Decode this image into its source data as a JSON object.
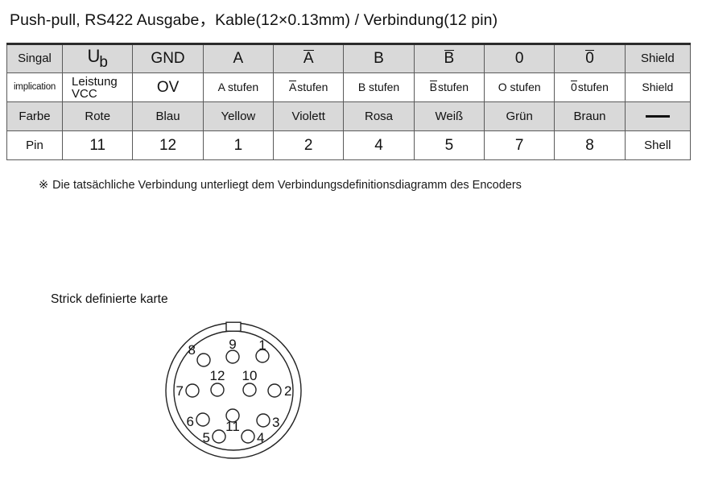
{
  "title": "Push-pull, RS422 Ausgabe，Kable(12×0.13mm)  / Verbindung(12 pin)",
  "table": {
    "rows": [
      {
        "name": "signal-row",
        "cells": [
          "Singal",
          "Ub",
          "GND",
          "A",
          "A",
          "B",
          "B",
          "0",
          "0",
          "Shield"
        ]
      },
      {
        "name": "implication-row",
        "cells": [
          "implication",
          "Leistung VCC",
          "OV",
          "A stufen",
          "A stufen",
          "B stufen",
          "B stufen",
          "O stufen",
          "0 stufen",
          "Shield"
        ]
      },
      {
        "name": "color-row",
        "cells": [
          "Farbe",
          "Rote",
          "Blau",
          "Yellow",
          "Violett",
          "Rosa",
          "Weiß",
          "Grün",
          "Braun",
          "—"
        ]
      },
      {
        "name": "pin-row",
        "cells": [
          "Pin",
          "11",
          "12",
          "1",
          "2",
          "4",
          "5",
          "7",
          "8",
          "Shell"
        ]
      }
    ],
    "signal": {
      "label": "Singal",
      "ub_main": "U",
      "ub_sub": "b",
      "gnd": "GND",
      "a": "A",
      "a_bar": "A",
      "b": "B",
      "b_bar": "B",
      "zero": "0",
      "zero_bar": "0",
      "shield": "Shield"
    },
    "implication": {
      "label": "implication",
      "ub_line1": "Leistung",
      "ub_line2": "VCC",
      "gnd": "OV",
      "a": "A stufen",
      "a_bar_mark": "A",
      "a_bar_text": "stufen",
      "b": "B stufen",
      "b_bar_mark": "B",
      "b_bar_text": "stufen",
      "zero": "O stufen",
      "zero_bar_mark": "0",
      "zero_bar_text": "stufen",
      "shield": "Shield"
    },
    "color": {
      "label": "Farbe",
      "ub": "Rote",
      "gnd": "Blau",
      "a": "Yellow",
      "a_bar": "Violett",
      "b": "Rosa",
      "b_bar": "Weiß",
      "zero": "Grün",
      "zero_bar": "Braun",
      "shield": "—"
    },
    "pin": {
      "label": "Pin",
      "ub": "11",
      "gnd": "12",
      "a": "1",
      "a_bar": "2",
      "b": "4",
      "b_bar": "5",
      "zero": "7",
      "zero_bar": "8",
      "shield": "Shell"
    }
  },
  "note": {
    "mark": "※",
    "text": "Die tatsächliche Verbindung unterliegt dem Verbindungsdefinitionsdiagramm des Encoders"
  },
  "connector": {
    "caption": "Strick definierte karte",
    "pins": [
      "1",
      "2",
      "3",
      "4",
      "5",
      "6",
      "7",
      "8",
      "9",
      "10",
      "11",
      "12"
    ],
    "pin_labels": {
      "p1": "1",
      "p2": "2",
      "p3": "3",
      "p4": "4",
      "p5": "5",
      "p6": "6",
      "p7": "7",
      "p8": "8",
      "p9": "9",
      "p10": "10",
      "p11": "11",
      "p12": "12"
    }
  },
  "colors": {
    "shaded_row": "#d9d9d9",
    "border": "#5a5a5a",
    "top_border": "#2b2b2b",
    "text": "#111111",
    "background": "#ffffff"
  }
}
